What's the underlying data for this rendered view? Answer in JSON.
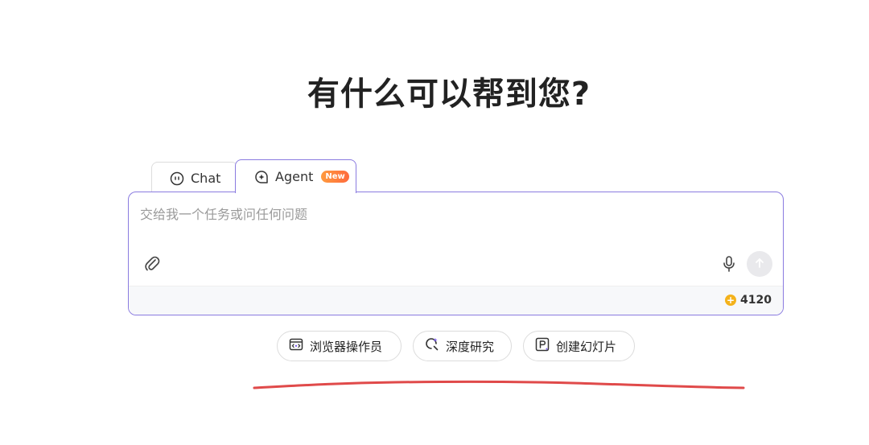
{
  "title": "有什么可以帮到您?",
  "tabs": {
    "chat_label": "Chat",
    "agent_label": "Agent",
    "agent_badge": "New"
  },
  "composer": {
    "placeholder": "交给我一个任务或问任何问题",
    "value": "",
    "credits": "4120"
  },
  "chips": [
    {
      "label": "浏览器操作员",
      "icon": "browser-icon"
    },
    {
      "label": "深度研究",
      "icon": "deep-research-icon"
    },
    {
      "label": "创建幻灯片",
      "icon": "slides-icon"
    }
  ],
  "colors": {
    "accent": "#8a7be0",
    "badge": "#ff7a3d",
    "coin": "#f4b21b",
    "annotation_line": "#e04a4a"
  }
}
